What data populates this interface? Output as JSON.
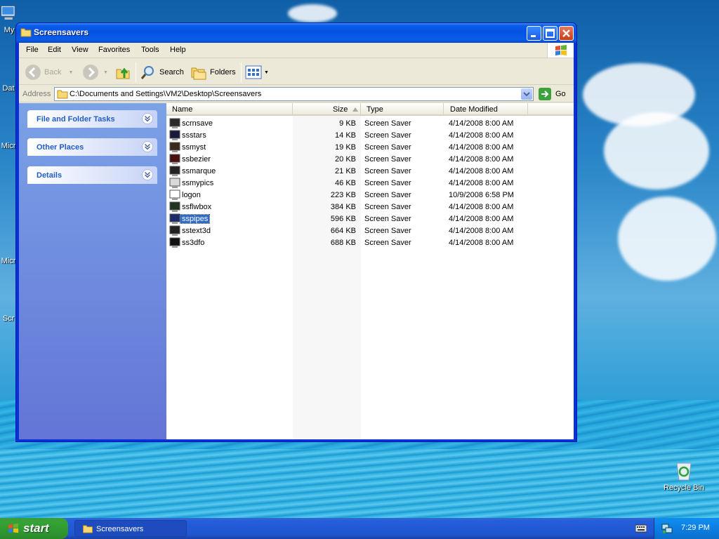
{
  "desktop": {
    "icons": [
      {
        "label": "My"
      },
      {
        "label": "Dat"
      },
      {
        "label": "Micr"
      },
      {
        "label": "Micr"
      },
      {
        "label": "Scr"
      },
      {
        "label": "Recycle Bin"
      }
    ]
  },
  "window": {
    "title": "Screensavers",
    "menu": [
      "File",
      "Edit",
      "View",
      "Favorites",
      "Tools",
      "Help"
    ],
    "toolbar": {
      "back": "Back",
      "search": "Search",
      "folders": "Folders"
    },
    "address": {
      "label": "Address",
      "path": "C:\\Documents and Settings\\VM2\\Desktop\\Screensavers",
      "go": "Go"
    },
    "task_groups": [
      "File and Folder Tasks",
      "Other Places",
      "Details"
    ],
    "columns": [
      "Name",
      "Size",
      "Type",
      "Date Modified"
    ],
    "files": [
      {
        "name": "scrnsave",
        "size": "9 KB",
        "type": "Screen Saver",
        "date": "4/14/2008 8:00 AM"
      },
      {
        "name": "ssstars",
        "size": "14 KB",
        "type": "Screen Saver",
        "date": "4/14/2008 8:00 AM"
      },
      {
        "name": "ssmyst",
        "size": "19 KB",
        "type": "Screen Saver",
        "date": "4/14/2008 8:00 AM"
      },
      {
        "name": "ssbezier",
        "size": "20 KB",
        "type": "Screen Saver",
        "date": "4/14/2008 8:00 AM"
      },
      {
        "name": "ssmarque",
        "size": "21 KB",
        "type": "Screen Saver",
        "date": "4/14/2008 8:00 AM"
      },
      {
        "name": "ssmypics",
        "size": "46 KB",
        "type": "Screen Saver",
        "date": "4/14/2008 8:00 AM"
      },
      {
        "name": "logon",
        "size": "223 KB",
        "type": "Screen Saver",
        "date": "10/9/2008 6:58 PM"
      },
      {
        "name": "ssflwbox",
        "size": "384 KB",
        "type": "Screen Saver",
        "date": "4/14/2008 8:00 AM"
      },
      {
        "name": "sspipes",
        "size": "596 KB",
        "type": "Screen Saver",
        "date": "4/14/2008 8:00 AM"
      },
      {
        "name": "sstext3d",
        "size": "664 KB",
        "type": "Screen Saver",
        "date": "4/14/2008 8:00 AM"
      },
      {
        "name": "ss3dfo",
        "size": "688 KB",
        "type": "Screen Saver",
        "date": "4/14/2008 8:00 AM"
      }
    ],
    "selected_file": "sspipes"
  },
  "taskbar": {
    "start": "start",
    "task": "Screensavers",
    "clock": "7:29 PM"
  },
  "colors": {
    "selection": "#316ac5",
    "task_link": "#215dc6",
    "title_bar": "#0453e4",
    "start_green": "#35a335"
  }
}
